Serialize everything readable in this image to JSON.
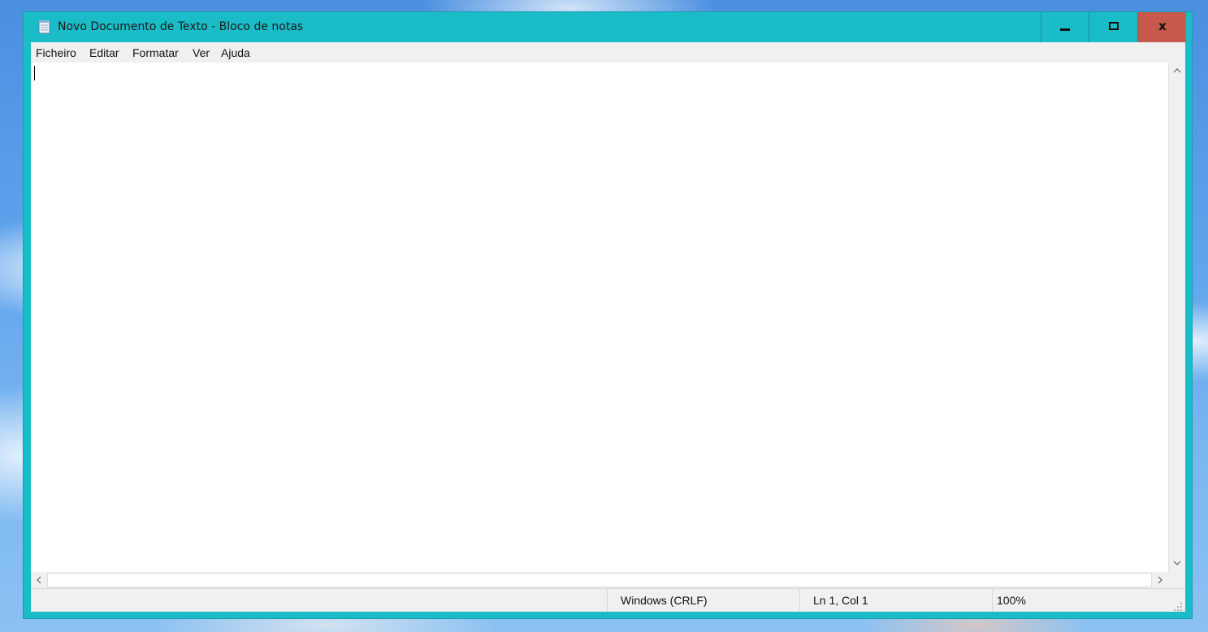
{
  "window": {
    "title": "Novo Documento de Texto - Bloco de notas",
    "accent_color": "#1abcc8",
    "close_color": "#c7584b",
    "app_icon": "notepad-icon"
  },
  "controls": {
    "minimize_icon": "minimize-icon",
    "maximize_icon": "maximize-icon",
    "close_label": "x"
  },
  "menubar": {
    "items": [
      {
        "label": "Ficheiro"
      },
      {
        "label": "Editar"
      },
      {
        "label": "Formatar"
      },
      {
        "label": "Ver"
      },
      {
        "label": "Ajuda"
      }
    ]
  },
  "editor": {
    "text": ""
  },
  "scrollbars": {
    "up_arrow": "chevron-up-icon",
    "down_arrow": "chevron-down-icon",
    "left_arrow": "chevron-left-icon",
    "right_arrow": "chevron-right-icon"
  },
  "statusbar": {
    "line_endings": "Windows (CRLF)",
    "position": "Ln 1, Col 1",
    "zoom": "100%"
  }
}
